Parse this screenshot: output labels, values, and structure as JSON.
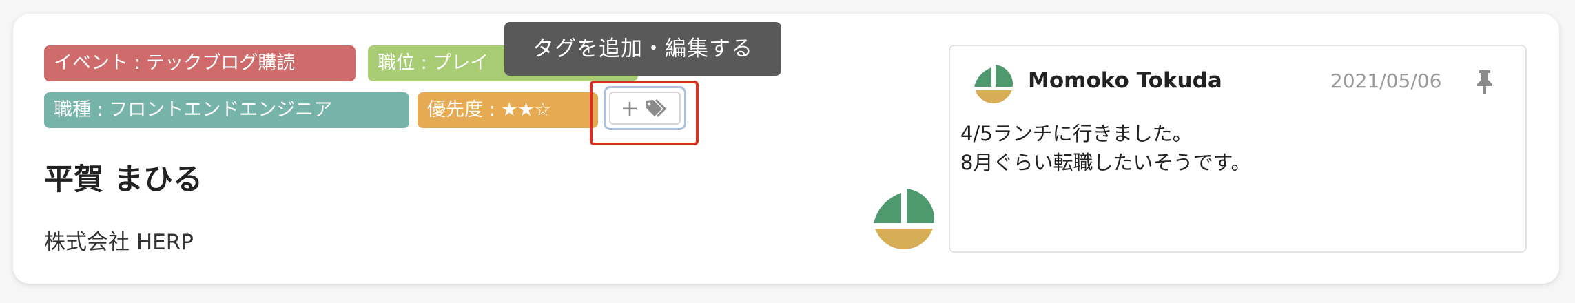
{
  "tags": {
    "event": "イベント : テックブログ購読",
    "position": "職位 : プレイ",
    "job_type": "職種 : フロントエンドエンジニア",
    "priority": "優先度 : ★★☆"
  },
  "add_tag": {
    "plus": "+",
    "icon": "tags-icon",
    "tooltip": "タグを追加・編集する"
  },
  "candidate": {
    "name": "平賀 まひる",
    "company": "株式会社 HERP"
  },
  "comment": {
    "author": "Momoko Tokuda",
    "date": "2021/05/06",
    "lines": [
      "4/5ランチに行きました。",
      "8月ぐらい転職したいそうです。"
    ],
    "pin_icon": "pin-icon"
  },
  "colors": {
    "event_tag": "#cf6b6b",
    "position_tag": "#a8cc73",
    "job_type_tag": "#76b3a9",
    "priority_tag": "#e5aa52",
    "highlight": "#d93025",
    "avatar_green": "#4e9a6e",
    "avatar_gold": "#d7ad55"
  }
}
